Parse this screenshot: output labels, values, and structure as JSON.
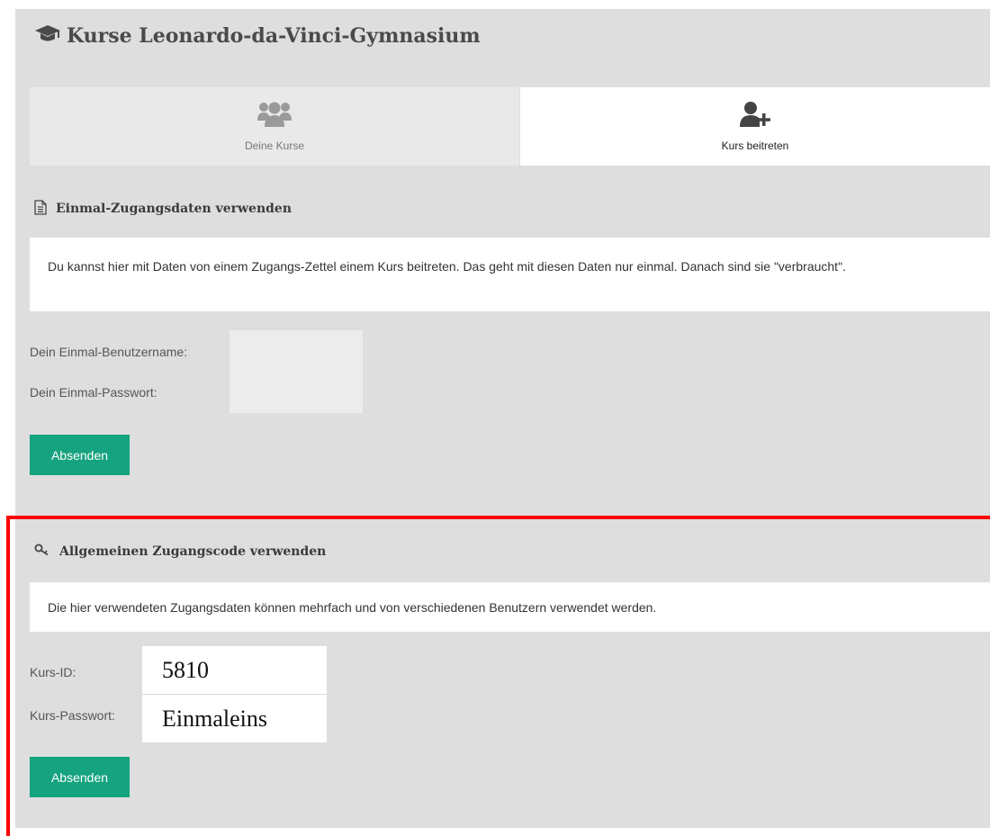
{
  "header": {
    "title": "Kurse Leonardo-da-Vinci-Gymnasium",
    "icon": "graduation-cap-icon"
  },
  "tabs": [
    {
      "label": "Deine Kurse",
      "icon": "users-group-icon",
      "active": false
    },
    {
      "label": "Kurs beitreten",
      "icon": "user-plus-icon",
      "active": true
    }
  ],
  "section_once": {
    "heading": "Einmal-Zugangsdaten verwenden",
    "icon": "document-icon",
    "info": "Du kannst hier mit Daten von einem Zugangs-Zettel einem Kurs beitreten. Das geht mit diesen Daten nur einmal. Danach sind sie \"verbraucht\".",
    "username_label": "Dein Einmal-Benutzername:",
    "password_label": "Dein Einmal-Passwort:",
    "username_value": "",
    "password_value": "",
    "submit_label": "Absenden"
  },
  "section_general": {
    "heading": "Allgemeinen Zugangscode verwenden",
    "icon": "key-icon",
    "info": "Die hier verwendeten Zugangsdaten können mehrfach und von verschiedenen Benutzern verwendet werden.",
    "course_id_label": "Kurs-ID:",
    "course_password_label": "Kurs-Passwort:",
    "course_id_value": "5810",
    "course_password_value": "Einmaleins",
    "submit_label": "Absenden"
  },
  "colors": {
    "accent": "#16a37f",
    "highlight": "#ff0000",
    "panel": "#dedede"
  }
}
